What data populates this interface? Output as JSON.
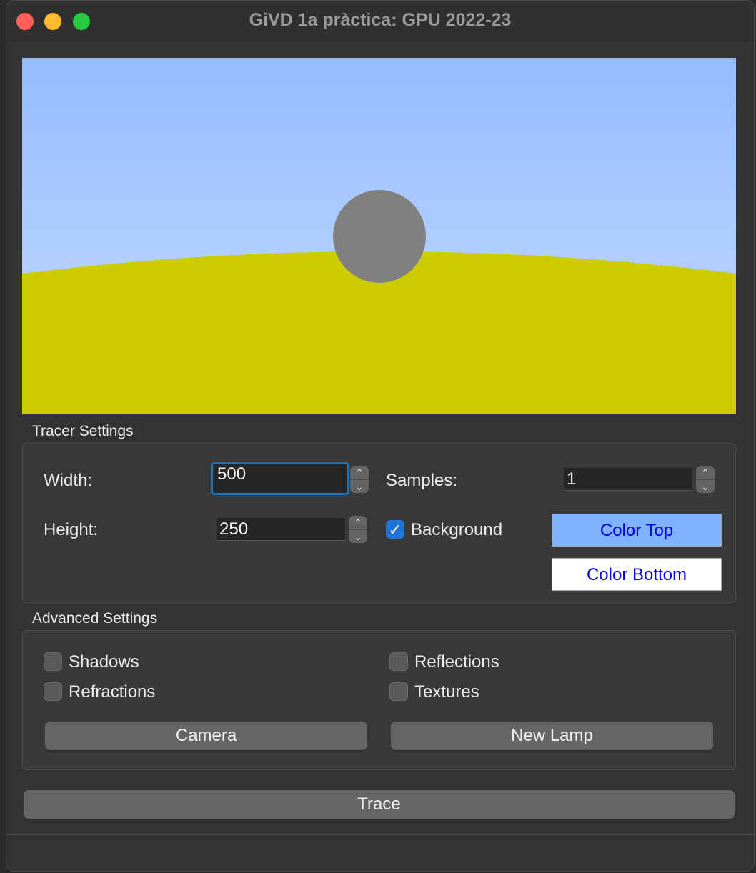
{
  "window": {
    "title": "GiVD 1a pràctica: GPU 2022-23"
  },
  "colors": {
    "sky_top": "#94bcff",
    "sky_bottom": "#c8dcff",
    "ground": "#cccc00",
    "sphere": "#808080",
    "color_top": "#80b3ff",
    "color_bottom": "#ffffff",
    "button_text": "#0000dd"
  },
  "tracer": {
    "group_label": "Tracer Settings",
    "width_label": "Width:",
    "width_value": "500",
    "height_label": "Height:",
    "height_value": "250",
    "samples_label": "Samples:",
    "samples_value": "1",
    "background_label": "Background",
    "background_checked": true,
    "color_top_label": "Color Top",
    "color_bottom_label": "Color Bottom"
  },
  "advanced": {
    "group_label": "Advanced Settings",
    "shadows_label": "Shadows",
    "reflections_label": "Reflections",
    "refractions_label": "Refractions",
    "textures_label": "Textures",
    "camera_label": "Camera",
    "new_lamp_label": "New Lamp"
  },
  "trace_label": "Trace",
  "icons": {
    "spin_up": "chevron-up-icon",
    "spin_down": "chevron-down-icon",
    "check": "checkmark-icon"
  }
}
